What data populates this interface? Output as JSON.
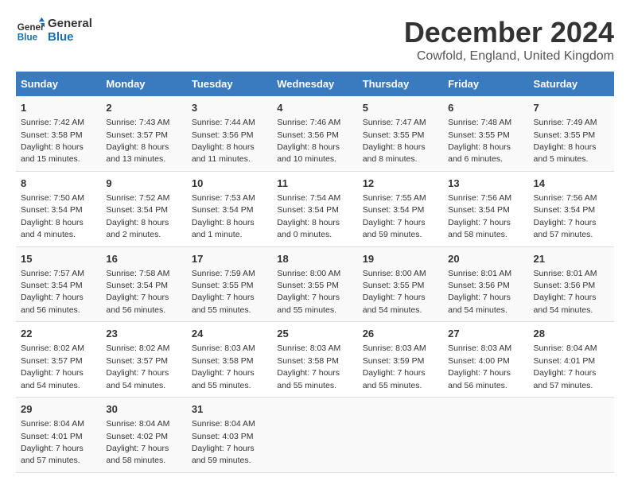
{
  "logo": {
    "line1": "General",
    "line2": "Blue"
  },
  "title": "December 2024",
  "subtitle": "Cowfold, England, United Kingdom",
  "header_days": [
    "Sunday",
    "Monday",
    "Tuesday",
    "Wednesday",
    "Thursday",
    "Friday",
    "Saturday"
  ],
  "weeks": [
    [
      {
        "day": "1",
        "sunrise": "Sunrise: 7:42 AM",
        "sunset": "Sunset: 3:58 PM",
        "daylight": "Daylight: 8 hours and 15 minutes."
      },
      {
        "day": "2",
        "sunrise": "Sunrise: 7:43 AM",
        "sunset": "Sunset: 3:57 PM",
        "daylight": "Daylight: 8 hours and 13 minutes."
      },
      {
        "day": "3",
        "sunrise": "Sunrise: 7:44 AM",
        "sunset": "Sunset: 3:56 PM",
        "daylight": "Daylight: 8 hours and 11 minutes."
      },
      {
        "day": "4",
        "sunrise": "Sunrise: 7:46 AM",
        "sunset": "Sunset: 3:56 PM",
        "daylight": "Daylight: 8 hours and 10 minutes."
      },
      {
        "day": "5",
        "sunrise": "Sunrise: 7:47 AM",
        "sunset": "Sunset: 3:55 PM",
        "daylight": "Daylight: 8 hours and 8 minutes."
      },
      {
        "day": "6",
        "sunrise": "Sunrise: 7:48 AM",
        "sunset": "Sunset: 3:55 PM",
        "daylight": "Daylight: 8 hours and 6 minutes."
      },
      {
        "day": "7",
        "sunrise": "Sunrise: 7:49 AM",
        "sunset": "Sunset: 3:55 PM",
        "daylight": "Daylight: 8 hours and 5 minutes."
      }
    ],
    [
      {
        "day": "8",
        "sunrise": "Sunrise: 7:50 AM",
        "sunset": "Sunset: 3:54 PM",
        "daylight": "Daylight: 8 hours and 4 minutes."
      },
      {
        "day": "9",
        "sunrise": "Sunrise: 7:52 AM",
        "sunset": "Sunset: 3:54 PM",
        "daylight": "Daylight: 8 hours and 2 minutes."
      },
      {
        "day": "10",
        "sunrise": "Sunrise: 7:53 AM",
        "sunset": "Sunset: 3:54 PM",
        "daylight": "Daylight: 8 hours and 1 minute."
      },
      {
        "day": "11",
        "sunrise": "Sunrise: 7:54 AM",
        "sunset": "Sunset: 3:54 PM",
        "daylight": "Daylight: 8 hours and 0 minutes."
      },
      {
        "day": "12",
        "sunrise": "Sunrise: 7:55 AM",
        "sunset": "Sunset: 3:54 PM",
        "daylight": "Daylight: 7 hours and 59 minutes."
      },
      {
        "day": "13",
        "sunrise": "Sunrise: 7:56 AM",
        "sunset": "Sunset: 3:54 PM",
        "daylight": "Daylight: 7 hours and 58 minutes."
      },
      {
        "day": "14",
        "sunrise": "Sunrise: 7:56 AM",
        "sunset": "Sunset: 3:54 PM",
        "daylight": "Daylight: 7 hours and 57 minutes."
      }
    ],
    [
      {
        "day": "15",
        "sunrise": "Sunrise: 7:57 AM",
        "sunset": "Sunset: 3:54 PM",
        "daylight": "Daylight: 7 hours and 56 minutes."
      },
      {
        "day": "16",
        "sunrise": "Sunrise: 7:58 AM",
        "sunset": "Sunset: 3:54 PM",
        "daylight": "Daylight: 7 hours and 56 minutes."
      },
      {
        "day": "17",
        "sunrise": "Sunrise: 7:59 AM",
        "sunset": "Sunset: 3:55 PM",
        "daylight": "Daylight: 7 hours and 55 minutes."
      },
      {
        "day": "18",
        "sunrise": "Sunrise: 8:00 AM",
        "sunset": "Sunset: 3:55 PM",
        "daylight": "Daylight: 7 hours and 55 minutes."
      },
      {
        "day": "19",
        "sunrise": "Sunrise: 8:00 AM",
        "sunset": "Sunset: 3:55 PM",
        "daylight": "Daylight: 7 hours and 54 minutes."
      },
      {
        "day": "20",
        "sunrise": "Sunrise: 8:01 AM",
        "sunset": "Sunset: 3:56 PM",
        "daylight": "Daylight: 7 hours and 54 minutes."
      },
      {
        "day": "21",
        "sunrise": "Sunrise: 8:01 AM",
        "sunset": "Sunset: 3:56 PM",
        "daylight": "Daylight: 7 hours and 54 minutes."
      }
    ],
    [
      {
        "day": "22",
        "sunrise": "Sunrise: 8:02 AM",
        "sunset": "Sunset: 3:57 PM",
        "daylight": "Daylight: 7 hours and 54 minutes."
      },
      {
        "day": "23",
        "sunrise": "Sunrise: 8:02 AM",
        "sunset": "Sunset: 3:57 PM",
        "daylight": "Daylight: 7 hours and 54 minutes."
      },
      {
        "day": "24",
        "sunrise": "Sunrise: 8:03 AM",
        "sunset": "Sunset: 3:58 PM",
        "daylight": "Daylight: 7 hours and 55 minutes."
      },
      {
        "day": "25",
        "sunrise": "Sunrise: 8:03 AM",
        "sunset": "Sunset: 3:58 PM",
        "daylight": "Daylight: 7 hours and 55 minutes."
      },
      {
        "day": "26",
        "sunrise": "Sunrise: 8:03 AM",
        "sunset": "Sunset: 3:59 PM",
        "daylight": "Daylight: 7 hours and 55 minutes."
      },
      {
        "day": "27",
        "sunrise": "Sunrise: 8:03 AM",
        "sunset": "Sunset: 4:00 PM",
        "daylight": "Daylight: 7 hours and 56 minutes."
      },
      {
        "day": "28",
        "sunrise": "Sunrise: 8:04 AM",
        "sunset": "Sunset: 4:01 PM",
        "daylight": "Daylight: 7 hours and 57 minutes."
      }
    ],
    [
      {
        "day": "29",
        "sunrise": "Sunrise: 8:04 AM",
        "sunset": "Sunset: 4:01 PM",
        "daylight": "Daylight: 7 hours and 57 minutes."
      },
      {
        "day": "30",
        "sunrise": "Sunrise: 8:04 AM",
        "sunset": "Sunset: 4:02 PM",
        "daylight": "Daylight: 7 hours and 58 minutes."
      },
      {
        "day": "31",
        "sunrise": "Sunrise: 8:04 AM",
        "sunset": "Sunset: 4:03 PM",
        "daylight": "Daylight: 7 hours and 59 minutes."
      },
      null,
      null,
      null,
      null
    ]
  ]
}
